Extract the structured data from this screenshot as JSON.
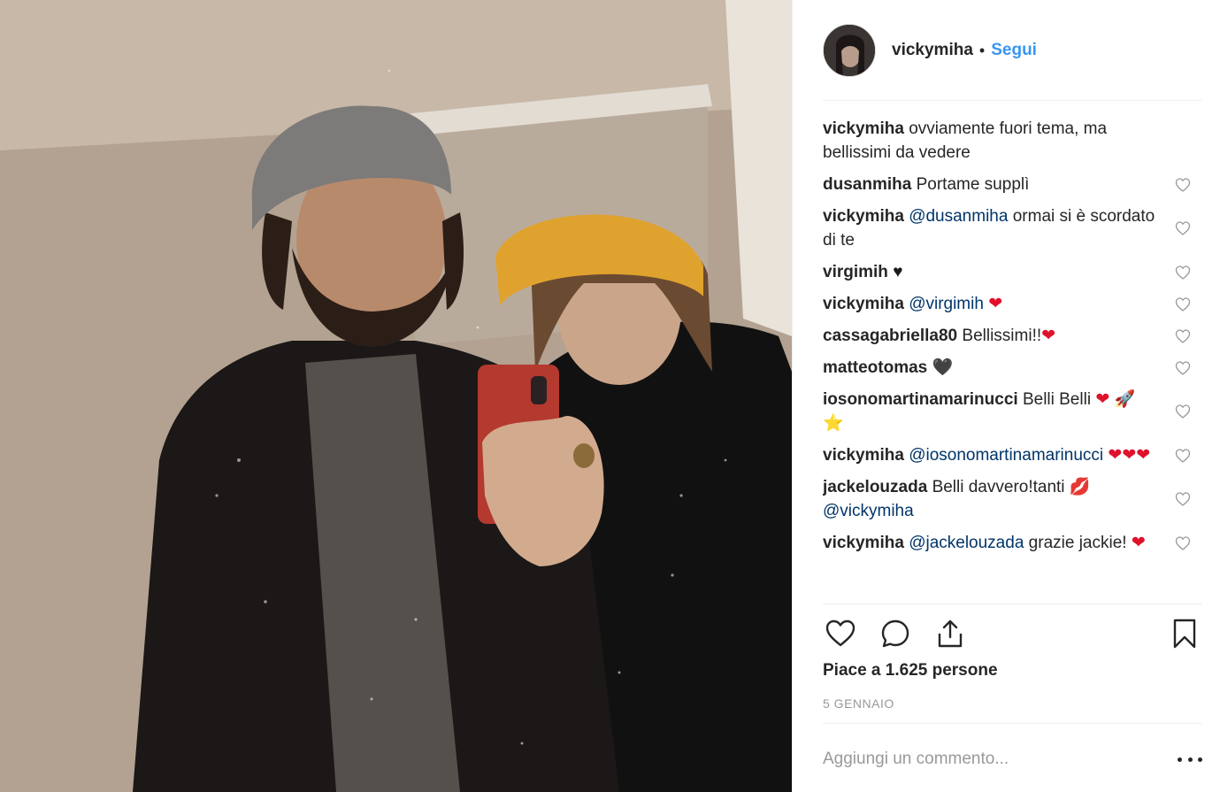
{
  "post": {
    "username": "vickymiha",
    "separator": "•",
    "follow_label": "Segui",
    "likes_text": "Piace a 1.625 persone",
    "date_text": "5 GENNAIO",
    "add_comment_placeholder": "Aggiungi un commento..."
  },
  "comments": [
    {
      "author": "vickymiha",
      "parts": [
        {
          "t": "text",
          "v": "ovviamente fuori tema, ma bellissimi da vedere"
        }
      ],
      "likeable": false
    },
    {
      "author": "dusanmiha",
      "parts": [
        {
          "t": "text",
          "v": "Portame supplì"
        }
      ],
      "likeable": true
    },
    {
      "author": "vickymiha",
      "parts": [
        {
          "t": "mention",
          "v": "@dusanmiha"
        },
        {
          "t": "text",
          "v": " ormai si è scordato di te"
        }
      ],
      "likeable": true
    },
    {
      "author": "virgimih",
      "parts": [
        {
          "t": "emoji",
          "v": "♥",
          "cls": "black"
        }
      ],
      "likeable": true
    },
    {
      "author": "vickymiha",
      "parts": [
        {
          "t": "mention",
          "v": "@virgimih"
        },
        {
          "t": "text",
          "v": " "
        },
        {
          "t": "emoji",
          "v": "❤",
          "cls": ""
        }
      ],
      "likeable": true
    },
    {
      "author": "cassagabriella80",
      "parts": [
        {
          "t": "text",
          "v": "Bellissimi!!"
        },
        {
          "t": "emoji",
          "v": "❤",
          "cls": ""
        }
      ],
      "likeable": true
    },
    {
      "author": "matteotomas",
      "parts": [
        {
          "t": "emoji",
          "v": "🖤",
          "cls": "black"
        }
      ],
      "likeable": true
    },
    {
      "author": "iosonomartinamarinucci",
      "parts": [
        {
          "t": "text",
          "v": "Belli Belli "
        },
        {
          "t": "emoji",
          "v": "❤",
          "cls": ""
        },
        {
          "t": "text",
          "v": " "
        },
        {
          "t": "emoji",
          "v": "🚀",
          "cls": "rocket"
        },
        {
          "t": "text",
          "v": " "
        },
        {
          "t": "emoji",
          "v": "⭐",
          "cls": "star"
        }
      ],
      "likeable": true
    },
    {
      "author": "vickymiha",
      "parts": [
        {
          "t": "mention",
          "v": "@iosonomartinamarinucci"
        },
        {
          "t": "text",
          "v": " "
        },
        {
          "t": "emoji",
          "v": "❤❤❤",
          "cls": ""
        }
      ],
      "likeable": true
    },
    {
      "author": "jackelouzada",
      "parts": [
        {
          "t": "text",
          "v": "Belli davvero!tanti "
        },
        {
          "t": "emoji",
          "v": "💋",
          "cls": "lips"
        },
        {
          "t": "text",
          "v": " "
        },
        {
          "t": "mention",
          "v": "@vickymiha"
        }
      ],
      "likeable": true
    },
    {
      "author": "vickymiha",
      "parts": [
        {
          "t": "mention",
          "v": "@jackelouzada"
        },
        {
          "t": "text",
          "v": " grazie jackie! "
        },
        {
          "t": "emoji",
          "v": "❤",
          "cls": ""
        }
      ],
      "likeable": true
    }
  ],
  "icons": {
    "like": "heart-outline-icon",
    "comment": "speech-bubble-icon",
    "share": "share-upload-icon",
    "save": "bookmark-icon",
    "more": "more-options-icon"
  },
  "colors": {
    "follow": "#3897f0",
    "mention": "#003569",
    "muted": "#999999",
    "text": "#262626"
  }
}
